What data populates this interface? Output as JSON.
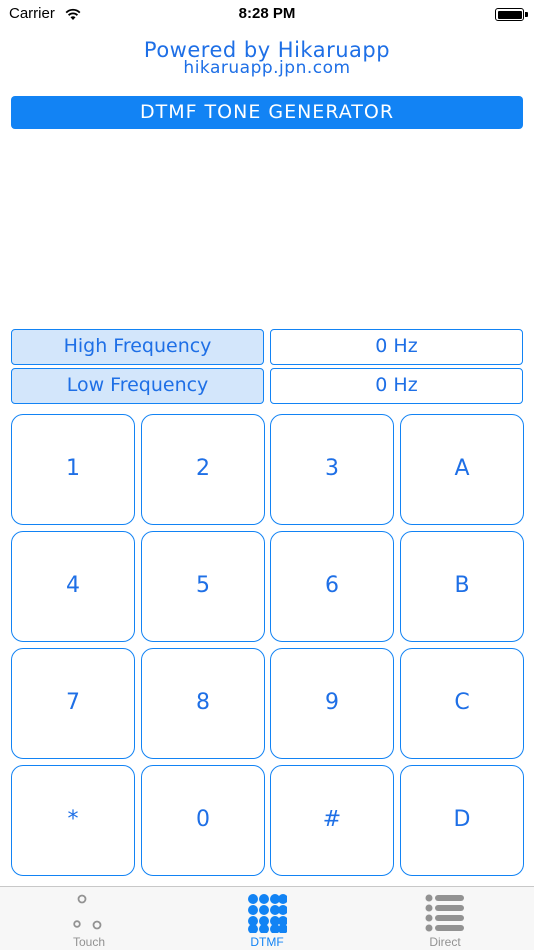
{
  "status_bar": {
    "carrier": "Carrier",
    "time": "8:28 PM"
  },
  "header": {
    "powered_by": "Powered by Hikaruapp",
    "website": "hikaruapp.jpn.com",
    "title": "DTMF TONE GENERATOR"
  },
  "frequencies": {
    "high_label": "High Frequency",
    "high_value": "0 Hz",
    "low_label": "Low Frequency",
    "low_value": "0 Hz"
  },
  "keypad": {
    "keys": [
      "1",
      "2",
      "3",
      "A",
      "4",
      "5",
      "6",
      "B",
      "7",
      "8",
      "9",
      "C",
      "*",
      "0",
      "#",
      "D"
    ]
  },
  "tab_bar": {
    "tabs": [
      {
        "label": "Touch",
        "icon": "touch-dots-icon",
        "active": false
      },
      {
        "label": "DTMF",
        "icon": "dtmf-grid-icon",
        "active": true
      },
      {
        "label": "Direct",
        "icon": "list-icon",
        "active": false
      }
    ]
  },
  "colors": {
    "accent": "#1283f4",
    "text_blue": "#1e6fe6",
    "label_bg": "#d3e6fb",
    "tab_inactive": "#929292"
  }
}
